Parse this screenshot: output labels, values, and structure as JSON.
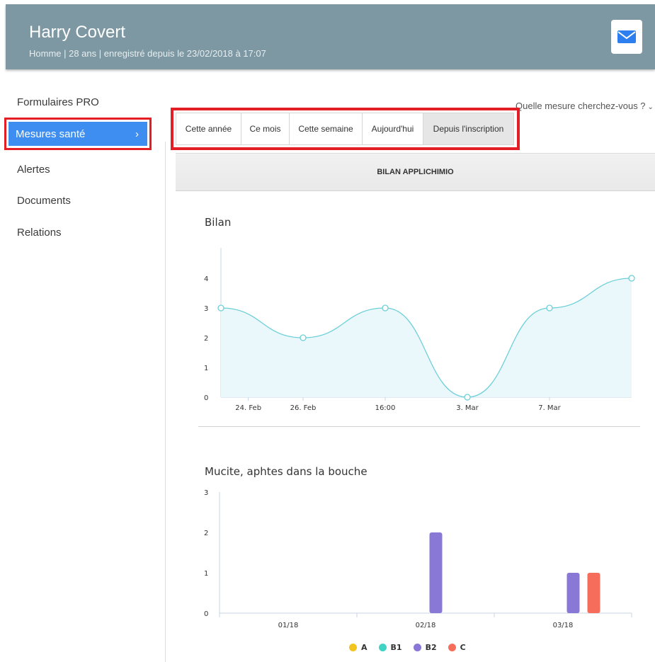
{
  "header": {
    "name": "Harry Covert",
    "subtitle": "Homme  |  28 ans  |  enregistré depuis le 23/02/2018 à 17:07"
  },
  "sidebar": {
    "items": [
      {
        "label": "Formulaires PRO"
      },
      {
        "label": "Mesures santé",
        "chevron": "›"
      },
      {
        "label": "Alertes"
      },
      {
        "label": "Documents"
      },
      {
        "label": "Relations"
      }
    ]
  },
  "search_prompt": "Quelle mesure cherchez-vous ?",
  "tabs": [
    {
      "label": "Cette année"
    },
    {
      "label": "Ce mois"
    },
    {
      "label": "Cette semaine"
    },
    {
      "label": "Aujourd'hui"
    },
    {
      "label": "Depuis l'inscription"
    }
  ],
  "section_title": "BILAN APPLICHIMIO",
  "colors": {
    "header_bg": "#7d98a2",
    "active_blue": "#3d8ef0",
    "highlight_red": "#e31e24",
    "line": "#6ccfd8",
    "area": "#eaf8fb",
    "series_A": "#f2c41f",
    "series_B1": "#3fd3c5",
    "series_B2": "#8a78d6",
    "series_C": "#f76d5b"
  },
  "chart_data": [
    {
      "type": "area",
      "title": "Bilan",
      "x_ticks": [
        "24. Feb",
        "26. Feb",
        "16:00",
        "3. Mar",
        "7. Mar"
      ],
      "y_ticks": [
        0,
        1,
        2,
        3,
        4
      ],
      "ylim": [
        0,
        5
      ],
      "points": [
        {
          "x": "2018-02-23",
          "y": 3
        },
        {
          "x": "2018-02-26",
          "y": 2
        },
        {
          "x": "2018-03-01",
          "y": 3
        },
        {
          "x": "2018-03-04",
          "y": 0
        },
        {
          "x": "2018-03-07",
          "y": 3
        },
        {
          "x": "2018-03-10",
          "y": 4
        }
      ],
      "grid": false
    },
    {
      "type": "bar",
      "title": "Mucite, aphtes dans la bouche",
      "categories": [
        "01/18",
        "02/18",
        "03/18"
      ],
      "y_ticks": [
        0,
        1,
        2,
        3
      ],
      "ylim": [
        0,
        3
      ],
      "series": [
        {
          "name": "A",
          "values": [
            0,
            0,
            0
          ]
        },
        {
          "name": "B1",
          "values": [
            0,
            0,
            0
          ]
        },
        {
          "name": "B2",
          "values": [
            0,
            2,
            1
          ]
        },
        {
          "name": "C",
          "values": [
            0,
            0,
            1
          ]
        }
      ],
      "legend": "bottom"
    }
  ]
}
